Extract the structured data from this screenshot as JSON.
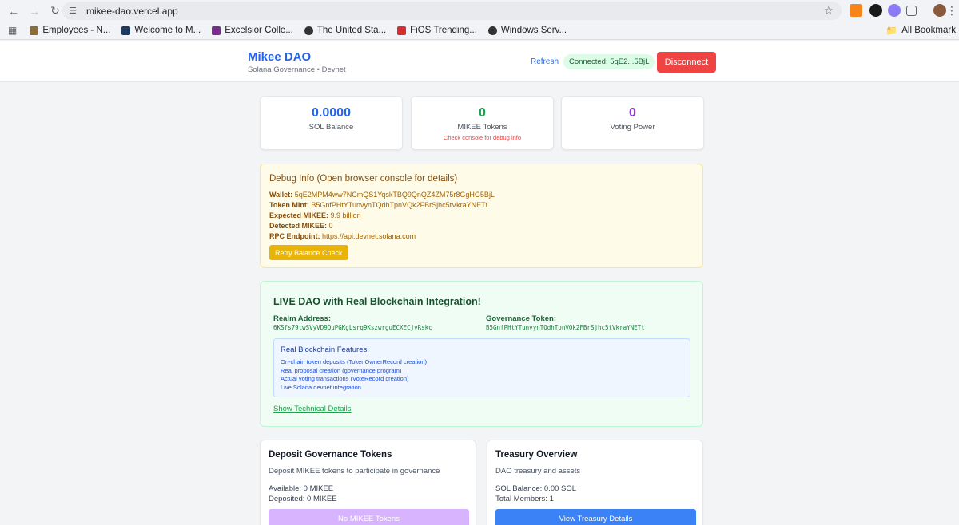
{
  "browser": {
    "url": "mikee-dao.vercel.app",
    "bookmarks": [
      {
        "label": "Employees - N...",
        "icon": "folder-icon",
        "color": "#8a6d3b"
      },
      {
        "label": "Welcome to M...",
        "icon": "site-icon",
        "color": "#1f3a5f"
      },
      {
        "label": "Excelsior Colle...",
        "icon": "site-icon",
        "color": "#7b2d8e"
      },
      {
        "label": "The United Sta...",
        "icon": "globe-icon",
        "color": "#333333"
      },
      {
        "label": "FiOS Trending...",
        "icon": "site-icon",
        "color": "#d32f2f"
      },
      {
        "label": "Windows Serv...",
        "icon": "globe-icon",
        "color": "#333333"
      }
    ],
    "all_bookmarks": "All Bookmark"
  },
  "header": {
    "title": "Mikee DAO",
    "subtitle": "Solana Governance • Devnet",
    "refresh": "Refresh",
    "connected": "Connected: 5qE2...5BjL",
    "disconnect": "Disconnect"
  },
  "stats": {
    "sol": {
      "value": "0.0000",
      "label": "SOL Balance",
      "color": "#2563eb"
    },
    "mikee": {
      "value": "0",
      "label": "MIKEE Tokens",
      "note": "Check console for debug info",
      "color": "#16a34a"
    },
    "voting": {
      "value": "0",
      "label": "Voting Power",
      "color": "#9333ea"
    }
  },
  "debug": {
    "title": "Debug Info (Open browser console for details)",
    "wallet_label": "Wallet:",
    "wallet": "5qE2MPM4ww7NCmQS1YqskTBQ9QnQZ4ZM75r8GgHG5BjL",
    "mint_label": "Token Mint:",
    "mint": "B5GnfPHtYTunvynTQdhTpnVQk2FBrSjhc5tVkraYNETt",
    "expected_label": "Expected MIKEE:",
    "expected": "9.9 billion",
    "detected_label": "Detected MIKEE:",
    "detected": "0",
    "rpc_label": "RPC Endpoint:",
    "rpc": "https://api.devnet.solana.com",
    "retry": "Retry Balance Check"
  },
  "live": {
    "title": "LIVE DAO with Real Blockchain Integration!",
    "realm_label": "Realm Address:",
    "realm": "6KSfs79twSVyVD9QuPGKgLsrq9KszwrguECXECjvRskc",
    "token_label": "Governance Token:",
    "token": "B5GnfPHtYTunvynTQdhTpnVQk2FBrSjhc5tVkraYNETt",
    "features_title": "Real Blockchain Features:",
    "features": [
      "On-chain token deposits (TokenOwnerRecord creation)",
      "Real proposal creation (governance program)",
      "Actual voting transactions (VoteRecord creation)",
      "Live Solana devnet integration"
    ],
    "tech_link": "Show Technical Details"
  },
  "deposit": {
    "title": "Deposit Governance Tokens",
    "desc": "Deposit MIKEE tokens to participate in governance",
    "available": "Available: 0 MIKEE",
    "deposited": "Deposited: 0 MIKEE",
    "button": "No MIKEE Tokens"
  },
  "treasury": {
    "title": "Treasury Overview",
    "desc": "DAO treasury and assets",
    "sol": "SOL Balance: 0.00 SOL",
    "members": "Total Members: 1",
    "button": "View Treasury Details"
  }
}
